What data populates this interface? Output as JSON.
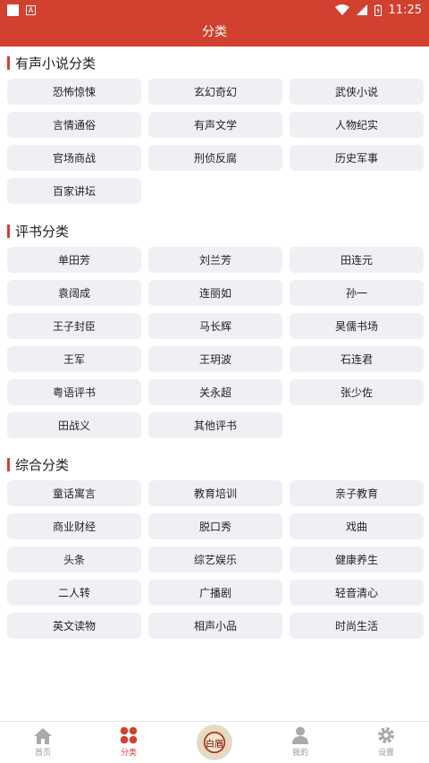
{
  "status_bar": {
    "time": "11:25",
    "badge": "A"
  },
  "header": {
    "title": "分类"
  },
  "sections": [
    {
      "title": "有声小说分类",
      "items": [
        "恐怖惊悚",
        "玄幻奇幻",
        "武侠小说",
        "言情通俗",
        "有声文学",
        "人物纪实",
        "官场商战",
        "刑侦反腐",
        "历史军事",
        "百家讲坛"
      ]
    },
    {
      "title": "评书分类",
      "items": [
        "单田芳",
        "刘兰芳",
        "田连元",
        "袁阔成",
        "连丽如",
        "孙一",
        "王子封臣",
        "马长辉",
        "昊儒书场",
        "王军",
        "王玥波",
        "石连君",
        "粤语评书",
        "关永超",
        "张少佐",
        "田战义",
        "其他评书"
      ]
    },
    {
      "title": "综合分类",
      "items": [
        "童话寓言",
        "教育培训",
        "亲子教育",
        "商业财经",
        "脱口秀",
        "戏曲",
        "头条",
        "综艺娱乐",
        "健康养生",
        "二人转",
        "广播剧",
        "轻音清心",
        "英文读物",
        "相声小品",
        "时尚生活"
      ]
    }
  ],
  "tabbar": {
    "home": "首页",
    "category": "分类",
    "album": "白眉",
    "mine": "我的",
    "settings": "设置"
  },
  "colors": {
    "accent": "#d2402f",
    "cell_bg": "#f0eff4"
  }
}
